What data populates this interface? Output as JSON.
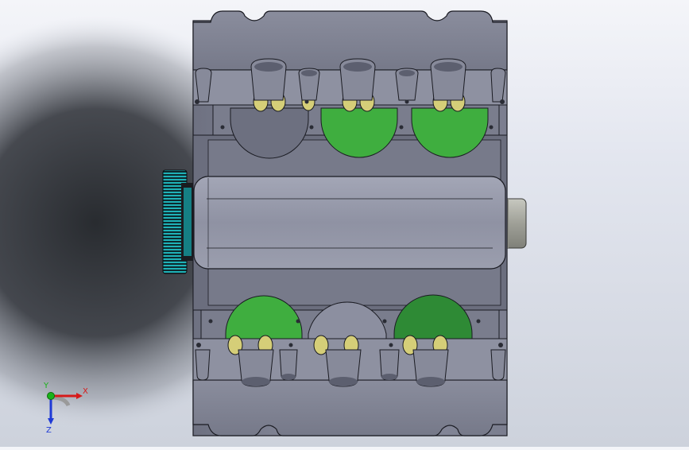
{
  "viewport": {
    "colors": {
      "background_top": "#f4f5f9",
      "background_bottom": "#cdd2dc",
      "shadow": "#1f2226",
      "body_gray": "#7d8091",
      "body_light": "#9a9cab",
      "body_dark": "#5f6272",
      "edge": "#1a1b22",
      "gear_teal": "#1fb2b7",
      "cavity_green": "#3fae3f",
      "cavity_dark_green": "#2e8a35",
      "bearing_yellow": "#d5ce78",
      "shaft_gray": "#a7a8a2"
    }
  },
  "triad": {
    "x_label": "X",
    "y_label": "Y",
    "z_label": "Z",
    "colors": {
      "x": "#d61a1a",
      "y": "#19b319",
      "z": "#1f3ad6"
    }
  }
}
